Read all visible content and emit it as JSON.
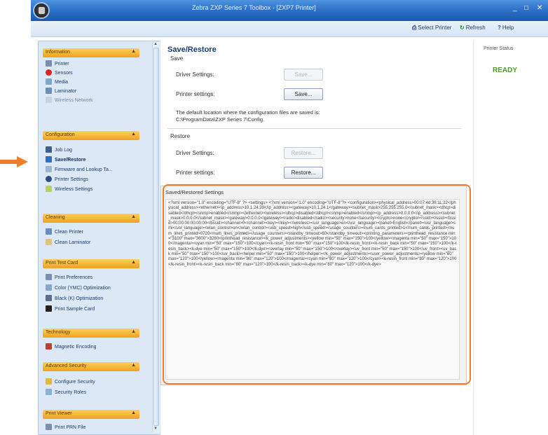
{
  "window": {
    "title": "Zebra ZXP Series 7 Toolbox - [ZXP7 Printer]",
    "controls": [
      "_",
      "□",
      "✕"
    ]
  },
  "toolbar": {
    "select_printer": "Select Printer",
    "refresh": "Refresh",
    "help": "Help"
  },
  "sidebar": {
    "groups": [
      {
        "label": "Information",
        "items": [
          "Printer",
          "Sensors",
          "Media",
          "Laminator",
          "Wireless Network"
        ]
      },
      {
        "label": "Configuration",
        "items": [
          "Job Log",
          "Save/Restore",
          "Firmware and Lookup Ta...",
          "Printer Settings",
          "Wireless Settings"
        ]
      },
      {
        "label": "Cleaning",
        "items": [
          "Clean Printer",
          "Clean Laminator"
        ]
      },
      {
        "label": "Print Test Card",
        "items": [
          "Print Preferences",
          "Color (YMC) Optimization",
          "Black (K) Optimization",
          "Print Sample Card"
        ]
      },
      {
        "label": "Technology",
        "items": [
          "Magnetic Encoding"
        ]
      },
      {
        "label": "Advanced Security",
        "items": [
          "Configure Security",
          "Security Roles"
        ]
      },
      {
        "label": "Print Viewer",
        "items": [
          "Print PRN File"
        ]
      }
    ]
  },
  "main": {
    "title": "Save/Restore",
    "save": {
      "label": "Save",
      "driver_label": "Driver Settings:",
      "driver_button": "Save...",
      "printer_label": "Printer settings:",
      "printer_button": "Save...",
      "note_line1": "The default location where the configuration files are saved is:",
      "note_line2": "C:\\ProgramData\\ZXP Series 7\\Config."
    },
    "restore": {
      "label": "Restore",
      "driver_label": "Driver Settings:",
      "driver_button": "Restore...",
      "printer_label": "Printer settings:",
      "printer_button": "Restore..."
    },
    "settings": {
      "title": "Saved/Restored Settings",
      "content": "<?xml version=\"1.0\" encoding=\"UTF-8\" ?> <settings> <?xml version=\"1.0\" encoding=\"UTF-8\"?> <configuration><physical_address>00:07:4d:36:11:22</physical_address><ethernet><ip_address>10.1.24.39</ip_address><gateway>10.1.24.1</gateway><subnet_mask>255.255.255.0</subnet_mask><dhcp>disabled</dhcp><snmp>enabled</snmp></ethernet><wireless><dhcp>disabled</dhcp><snmp>enabled</snmp><ip_address>0.0.0.0</ip_address><subnet_mask>0.0.0.0</subnet_mask><gateway>0.0.0.0</gateway><radio>disabled</radio><security>none</security><crypto>none</crypto><ssid></ssid><bssid>00:00:00:00:00:00</bssid><channel>0</channel><key></key></wireless><usr_language>en</usr_language><panel>English</panel><usr_language>smi</usr_language><wlan_control>on</wlan_control><usb_speed>high</usb_speed><usage_counters><num_cards_printed>1</num_cards_printed><num_lines_printed>0720</num_lines_printed></usage_counters><standby_timeout>60</standby_timeout><printing_parameters><printhead_resistance min=\"3100\" max=\"3600\">3260</printhead_resistance><k_power_adjustments><yellow min=\"50\" max=\"150\">100</yellow><magenta min=\"50\" max=\"150\">100</magenta><cyan min=\"50\" max=\"150\">100</cyan><k-resin_front min=\"50\" max=\"150\">100</k-resin_front><k-resin_back min=\"50\" max=\"150\">100</k-resin_back><k-dye min=\"50\" max=\"150\">100</k-dye><overlay min=\"50\" max=\"150\">100</overlay><uv_front min=\"50\" max=\"150\">100</uv_front><uv_back min=\"50\" max=\"150\">100</uv_back><helper min=\"50\" max=\"150\">100</helper></k_power_adjustments><user_power_adjustments><yellow min=\"80\" max=\"120\">100</yellow><magenta min=\"80\" max=\"120\">100</magenta><cyan min=\"80\" max=\"120\">100</cyan><k-resin_front min=\"80\" max=\"120\">100</k-resin_front><k-resin_back min=\"80\" max=\"120\">100</k-resin_back><k-dye min=\"80\" max=\"120\">100</k-dye>"
    }
  },
  "status": {
    "label": "Printer Status",
    "value": "READY"
  },
  "colors": {
    "accent": "#f07d2e",
    "ready": "#4c9a2a",
    "group_header": "#f0a020"
  }
}
